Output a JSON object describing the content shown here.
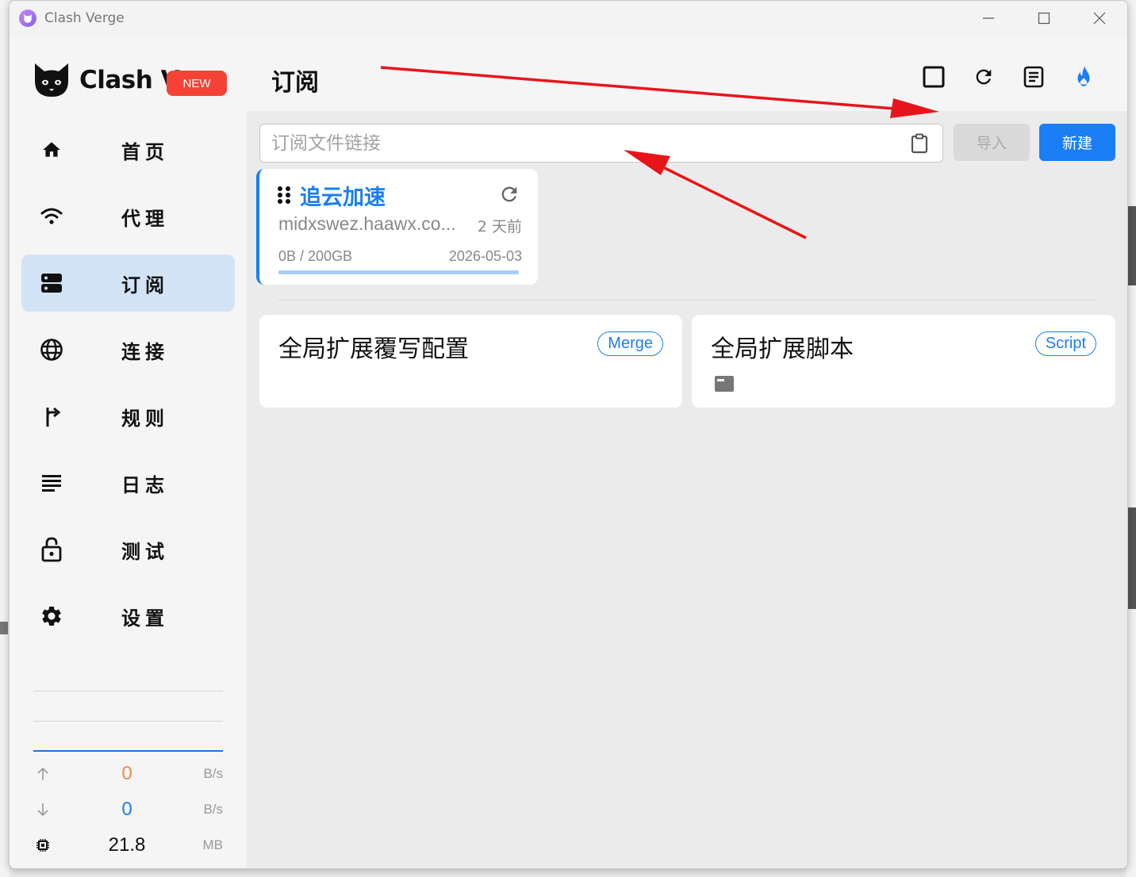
{
  "window": {
    "title": "Clash Verge"
  },
  "sidebar": {
    "logo_text": "Clash V",
    "new_badge": "NEW",
    "items": [
      {
        "label": "首页",
        "icon": "home-icon",
        "active": false
      },
      {
        "label": "代理",
        "icon": "wifi-icon",
        "active": false
      },
      {
        "label": "订阅",
        "icon": "dns-icon",
        "active": true
      },
      {
        "label": "连接",
        "icon": "globe-icon",
        "active": false
      },
      {
        "label": "规则",
        "icon": "fork-right-icon",
        "active": false
      },
      {
        "label": "日志",
        "icon": "subject-icon",
        "active": false
      },
      {
        "label": "测试",
        "icon": "lock-open-icon",
        "active": false
      },
      {
        "label": "设置",
        "icon": "gear-icon",
        "active": false
      }
    ],
    "traffic": {
      "up_value": "0",
      "up_unit": "B/s",
      "up_color": "#f5894b",
      "down_value": "0",
      "down_unit": "B/s",
      "down_color": "#1a7ef5",
      "memory_value": "21.8",
      "memory_unit": "MB"
    }
  },
  "header": {
    "title": "订阅",
    "icons": [
      "stop-square-icon",
      "refresh-icon",
      "document-icon",
      "fire-icon"
    ]
  },
  "import_bar": {
    "placeholder": "订阅文件链接",
    "value": "",
    "import_label": "导入",
    "new_label": "新建"
  },
  "profile": {
    "name": "追云加速",
    "host": "midxswez.haawx.co...",
    "updated": "2 天前",
    "usage": "0B / 200GB",
    "expire": "2026-05-03",
    "usage_fraction": 0
  },
  "extensions": [
    {
      "title": "全局扩展覆写配置",
      "tag": "Merge"
    },
    {
      "title": "全局扩展脚本",
      "tag": "Script"
    }
  ],
  "colors": {
    "accent": "#1a7ef5",
    "active_nav_bg": "#d3e3f6",
    "badge_red": "#f44336",
    "annotation_arrow": "#e8141b"
  }
}
